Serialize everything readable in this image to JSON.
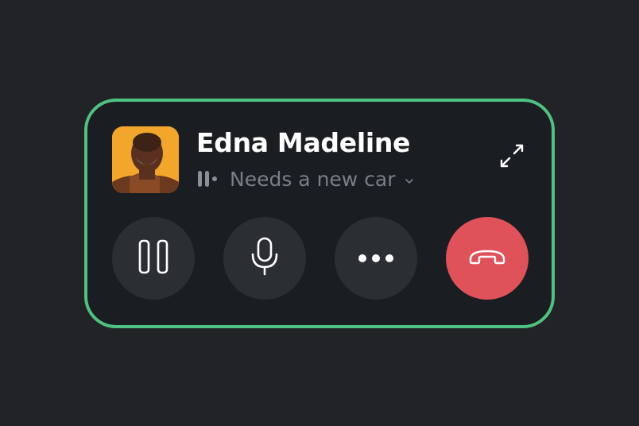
{
  "call": {
    "contact_name": "Edna Madeline",
    "status_text": "Needs a new car",
    "avatar_description": "portrait-photo"
  },
  "icons": {
    "status": "audio-level-icon",
    "dropdown": "chevron-down-icon",
    "expand": "expand-icon",
    "pause": "pause-icon",
    "mic": "microphone-icon",
    "more": "more-dots-icon",
    "hangup": "hang-up-phone-icon"
  },
  "colors": {
    "background": "#212326",
    "card": "#1a1d21",
    "card_border": "#4fc282",
    "button": "#2b2e33",
    "hangup": "#e0525a",
    "name_text": "#ffffff",
    "status_text": "#7a7e86"
  }
}
